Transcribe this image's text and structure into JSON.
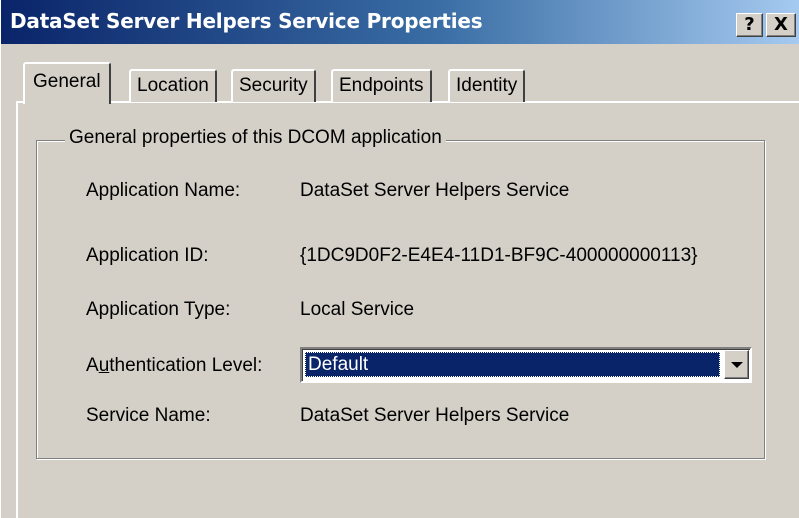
{
  "window": {
    "title": "DataSet Server Helpers Service Properties",
    "help_glyph": "?",
    "close_glyph": "X"
  },
  "tabs": [
    {
      "label": "General",
      "active": true
    },
    {
      "label": "Location",
      "active": false
    },
    {
      "label": "Security",
      "active": false
    },
    {
      "label": "Endpoints",
      "active": false
    },
    {
      "label": "Identity",
      "active": false
    }
  ],
  "group": {
    "legend": "General properties of this DCOM application"
  },
  "properties": {
    "app_name": {
      "label": "Application Name:",
      "value": "DataSet Server Helpers Service"
    },
    "app_id": {
      "label": "Application ID:",
      "value": "{1DC9D0F2-E4E4-11D1-BF9C-400000000113}"
    },
    "app_type": {
      "label": "Application Type:",
      "value": "Local Service"
    },
    "auth_level": {
      "label_prefix": "A",
      "label_mnemonic": "u",
      "label_rest": "thentication Level:",
      "value": "Default"
    },
    "service_name": {
      "label": "Service Name:",
      "value": "DataSet Server Helpers Service"
    }
  },
  "colors": {
    "title_bar": "#0a246a",
    "dialog_face": "#d4d0c8",
    "selection": "#0a246a"
  }
}
